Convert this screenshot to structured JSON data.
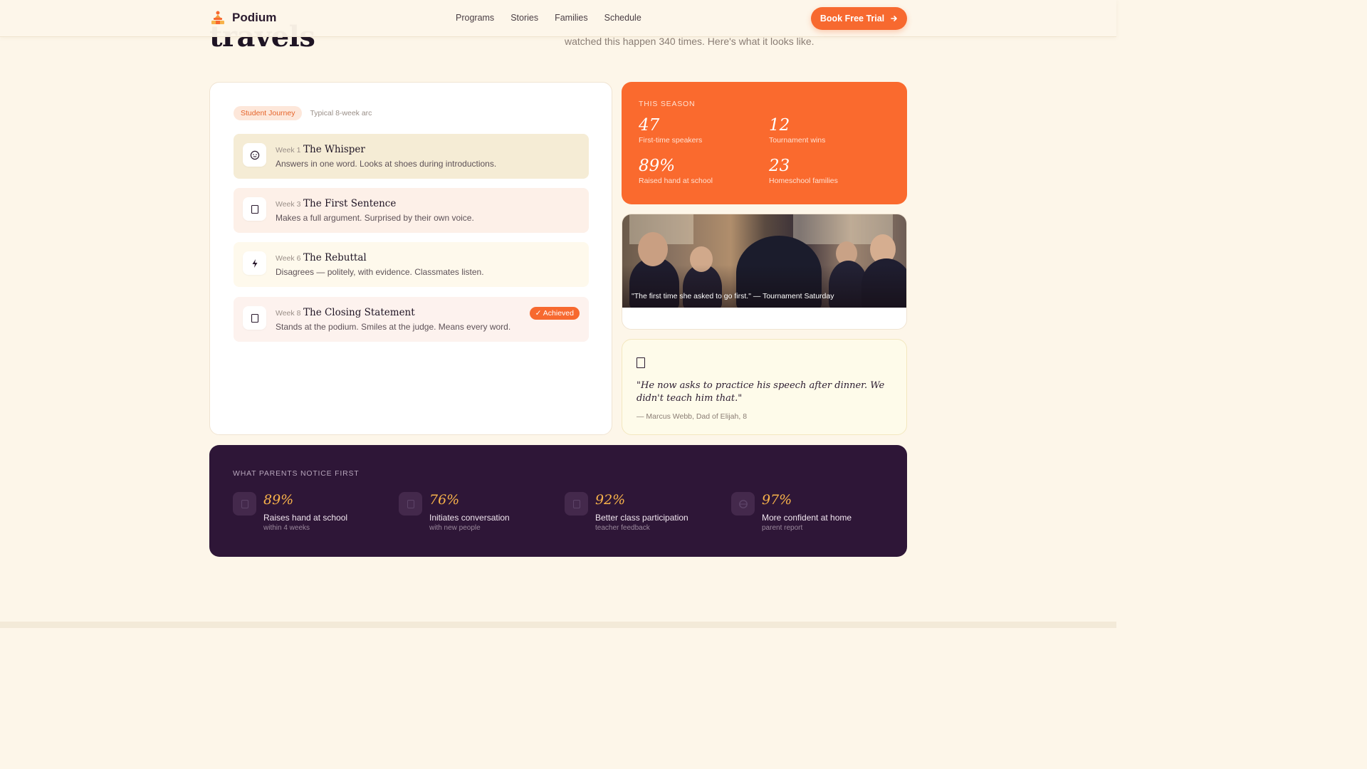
{
  "hero": {
    "title_fragment": "travels",
    "subtitle_fragment": "watched this happen 340 times. Here's what it looks like."
  },
  "nav": {
    "brand": "Podium",
    "links": [
      "Programs",
      "Stories",
      "Families",
      "Schedule"
    ],
    "cta_label": "Book Free Trial",
    "cta_icon": "arrow-right-icon"
  },
  "journey": {
    "pill": "Student Journey",
    "subtitle": "Typical 8-week arc",
    "steps": [
      {
        "week": "Week 1",
        "title": "The Whisper",
        "desc": "Answers in one word. Looks at shoes during introductions.",
        "icon": "neutral-face-icon",
        "glyph": "☺",
        "bg": "#f5ecd5"
      },
      {
        "week": "Week 3",
        "title": "The First Sentence",
        "desc": "Makes a full argument. Surprised by their own voice.",
        "icon": "speech-icon",
        "glyph": "▯",
        "bg": "#fdf0e8"
      },
      {
        "week": "Week 6",
        "title": "The Rebuttal",
        "desc": "Disagrees — politely, with evidence. Classmates listen.",
        "icon": "lightning-icon",
        "glyph": "⚡",
        "bg": "#fef9ec"
      },
      {
        "week": "Week 8",
        "title": "The Closing Statement",
        "desc": "Stands at the podium. Smiles at the judge. Means every word.",
        "icon": "podium-icon",
        "glyph": "▯",
        "bg": "#fdf2ee",
        "badge": "✓ Achieved"
      }
    ]
  },
  "season": {
    "label": "THIS SEASON",
    "stats": [
      {
        "value": "47",
        "label": "First-time speakers"
      },
      {
        "value": "12",
        "label": "Tournament wins"
      },
      {
        "value": "89%",
        "label": "Raised hand at school"
      },
      {
        "value": "23",
        "label": "Homeschool families"
      }
    ]
  },
  "photo": {
    "caption": "\"The first time she asked to go first.\" — Tournament Saturday"
  },
  "quote": {
    "text": "\"He now asks to practice his speech after dinner. We didn't teach him that.\"",
    "author": "— Marcus Webb, Dad of Elijah, 8"
  },
  "parents": {
    "label": "WHAT PARENTS NOTICE FIRST",
    "metrics": [
      {
        "value": "89%",
        "label": "Raises hand at school",
        "sub": "within 4 weeks",
        "icon": "hand-icon"
      },
      {
        "value": "76%",
        "label": "Initiates conversation",
        "sub": "with new people",
        "icon": "chat-icon"
      },
      {
        "value": "92%",
        "label": "Better class participation",
        "sub": "teacher feedback",
        "icon": "classroom-icon"
      },
      {
        "value": "97%",
        "label": "More confident at home",
        "sub": "parent report",
        "icon": "home-icon"
      }
    ]
  },
  "colors": {
    "accent": "#f7692f",
    "background": "#fdf6e9",
    "panel_dark": "#2e1637",
    "highlight_gold": "#f7b24a"
  }
}
